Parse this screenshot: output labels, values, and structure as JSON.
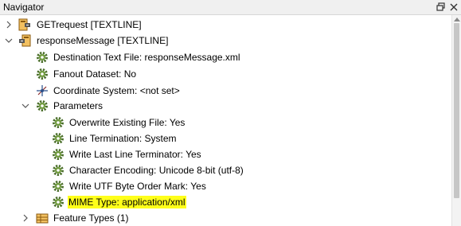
{
  "panel": {
    "title": "Navigator",
    "icons": [
      "restore-icon",
      "close-icon"
    ]
  },
  "tree": {
    "items": [
      {
        "label": "GETrequest [TEXTLINE]",
        "icon": "reader-icon",
        "expander": "collapsed"
      },
      {
        "label": "responseMessage [TEXTLINE]",
        "icon": "writer-icon",
        "expander": "expanded"
      },
      {
        "label": "Destination Text File: responseMessage.xml",
        "icon": "gear-icon"
      },
      {
        "label": "Fanout Dataset: No",
        "icon": "gear-icon"
      },
      {
        "label": "Coordinate System: <not set>",
        "icon": "coordinate-system-icon"
      },
      {
        "label": "Parameters",
        "icon": "gear-icon",
        "expander": "expanded"
      },
      {
        "label": "Overwrite Existing File: Yes",
        "icon": "gear-icon"
      },
      {
        "label": "Line Termination: System",
        "icon": "gear-icon"
      },
      {
        "label": "Write Last Line Terminator: Yes",
        "icon": "gear-icon"
      },
      {
        "label": "Character Encoding: Unicode 8-bit (utf-8)",
        "icon": "gear-icon"
      },
      {
        "label": "Write UTF Byte Order Mark: Yes",
        "icon": "gear-icon"
      },
      {
        "label": "MIME Type: application/xml",
        "icon": "gear-icon",
        "highlighted": true
      },
      {
        "label": "Feature Types (1)",
        "icon": "feature-types-icon",
        "expander": "collapsed"
      }
    ]
  },
  "colors": {
    "highlight": "#ffff1a",
    "gear": "#4a6e2a",
    "reader_body": "#e8a33a",
    "writer_body": "#e8a33a"
  }
}
